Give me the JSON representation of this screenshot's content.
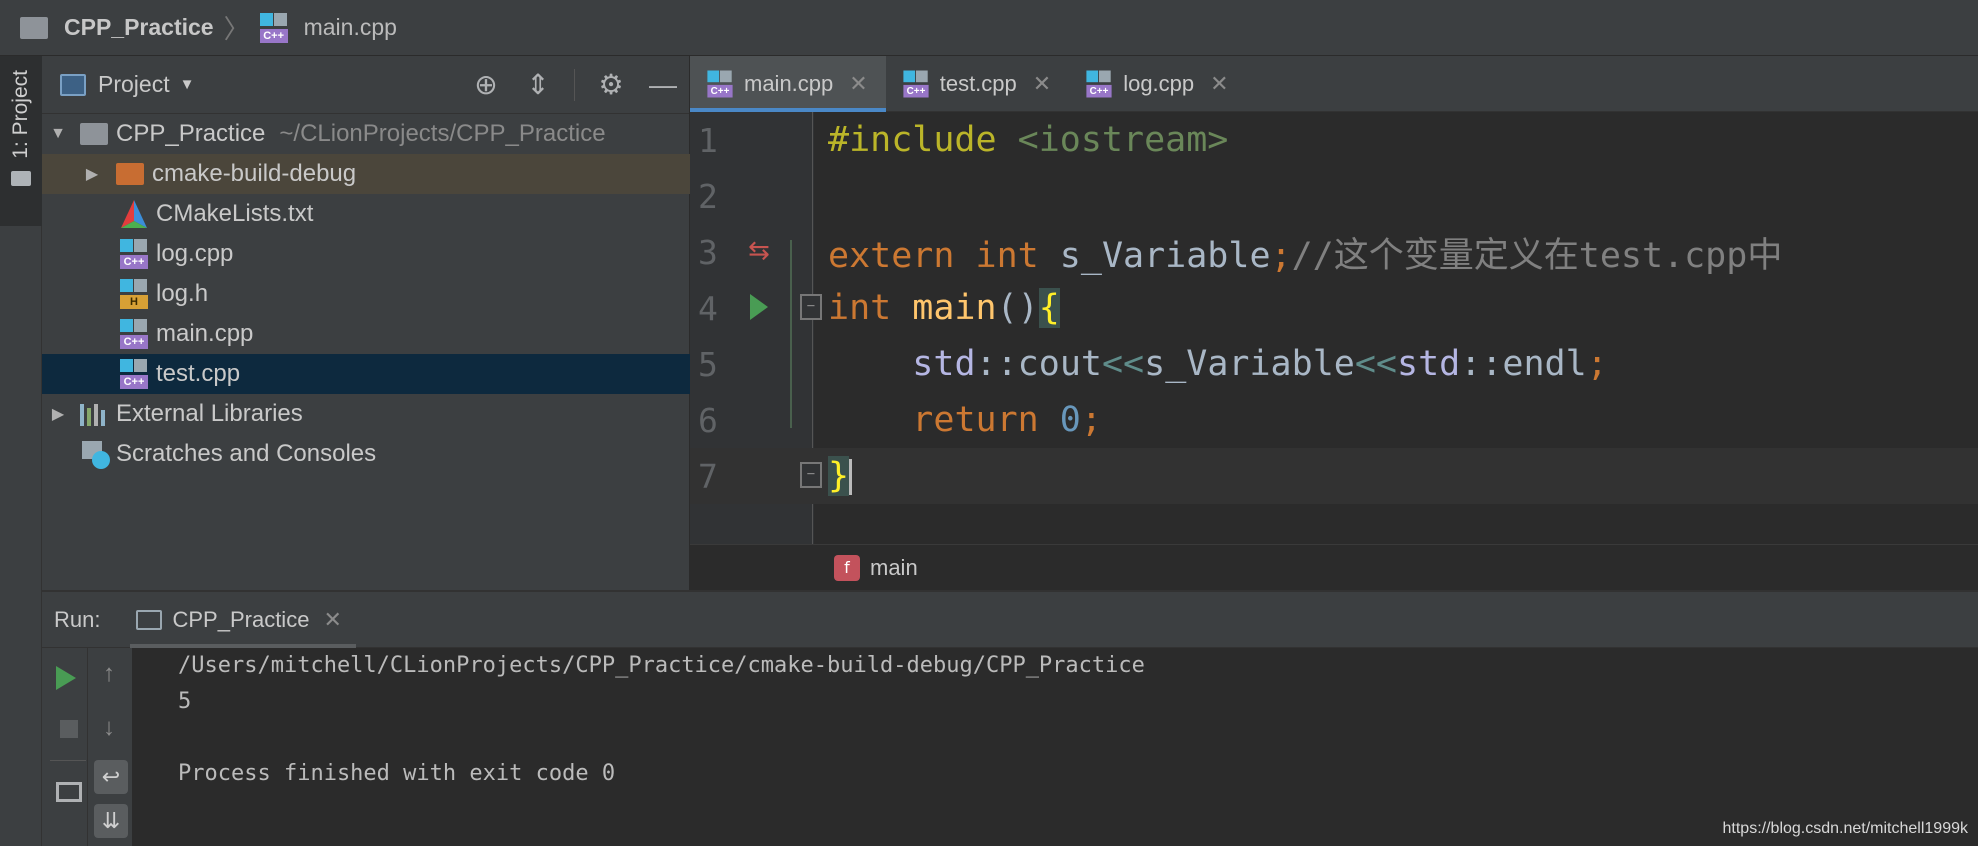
{
  "navbar": {
    "project": "CPP_Practice",
    "file": "main.cpp"
  },
  "left_strip": {
    "project_tab": "1: Project"
  },
  "project_panel": {
    "title": "Project",
    "tree": [
      {
        "label": "CPP_Practice",
        "path": "~/CLionProjects/CPP_Practice"
      },
      {
        "label": "cmake-build-debug"
      },
      {
        "label": "CMakeLists.txt"
      },
      {
        "label": "log.cpp"
      },
      {
        "label": "log.h"
      },
      {
        "label": "main.cpp"
      },
      {
        "label": "test.cpp"
      },
      {
        "label": "External Libraries"
      },
      {
        "label": "Scratches and Consoles"
      }
    ]
  },
  "editor_tabs": [
    {
      "label": "main.cpp",
      "active": true
    },
    {
      "label": "test.cpp",
      "active": false
    },
    {
      "label": "log.cpp",
      "active": false
    }
  ],
  "editor": {
    "line_numbers": [
      "1",
      "2",
      "3",
      "4",
      "5",
      "6",
      "7"
    ],
    "lines": {
      "l1_pp": "#include",
      "l1_str": " <iostream>",
      "l3_kw1": "extern",
      "l3_kw2": " int",
      "l3_id": " s_Variable",
      "l3_semi": ";",
      "l3_cm": "//这个变量定义在test.cpp中",
      "l4_kw": "int",
      "l4_fn": " main",
      "l4_paren": "()",
      "l4_brace": "{",
      "l5_ns1": "std",
      "l5_colon1": "::",
      "l5_id1": "cout",
      "l5_op1": "<<",
      "l5_id2": "s_Variable",
      "l5_op2": "<<",
      "l5_ns2": "std",
      "l5_colon2": "::",
      "l5_id3": "endl",
      "l5_semi": ";",
      "l6_kw": "return",
      "l6_num": " 0",
      "l6_semi": ";",
      "l7_brace": "}"
    },
    "breadcrumb_badge": "f",
    "breadcrumb_function": "main"
  },
  "run_panel": {
    "label": "Run:",
    "tab": "CPP_Practice",
    "output": [
      "/Users/mitchell/CLionProjects/CPP_Practice/cmake-build-debug/CPP_Practice",
      "5",
      "",
      "Process finished with exit code 0"
    ]
  },
  "watermark": "https://blog.csdn.net/mitchell1999k",
  "colors": {
    "background": "#2b2b2b",
    "panel": "#3c3f41",
    "accent": "#4a88c7",
    "keyword": "#cc7832",
    "string": "#6a8759",
    "function": "#ffc66d",
    "number": "#6897bb",
    "comment": "#808080",
    "run_green": "#499c54"
  }
}
